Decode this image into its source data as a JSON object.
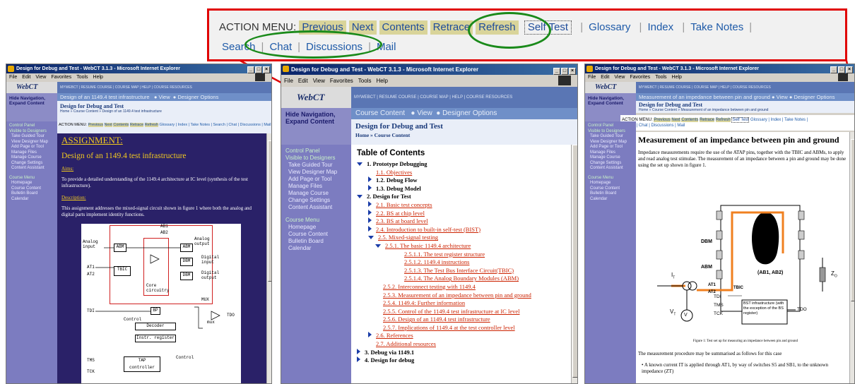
{
  "callout": {
    "action_menu": "ACTION MENU:",
    "buttons": [
      "Previous",
      "Next",
      "Contents",
      "Retrace",
      "Refresh"
    ],
    "self_test": "Self Test",
    "links_row1": [
      "Glossary",
      "Index",
      "Take Notes"
    ],
    "links_row2": [
      "Search",
      "Chat",
      "Discussions",
      "Mail"
    ]
  },
  "win1": {
    "title": "Design for Debug and Test - WebCT 3.1.3 - Microsoft Internet Explorer",
    "menu": [
      "File",
      "Edit",
      "View",
      "Favorites",
      "Tools",
      "Help"
    ],
    "logo": "WebCT",
    "topnav": "MYWEBCT | RESUME COURSE | COURSE MAP | HELP | COURSE RESOURCES",
    "hide_nav": "Hide Navigation, Expand Content",
    "crumb_title": "Design of an 1149.4 test infrastructure",
    "view": "View",
    "designer_options": "Designer Options",
    "page_title": "Design for Debug and Test",
    "breadcrumb": "Home » Course Content » Design of an 1149.4 test infrastructure",
    "action_label": "ACTION MENU:",
    "action_buttons": [
      "Previous",
      "Next",
      "Contents",
      "Retrace",
      "Refresh"
    ],
    "action_links": "Glossary | Index | Take Notes | Search | Chat | Discussions | Mail",
    "side": [
      "Control Panel",
      "Visible to Designers",
      "Take Guided Tour",
      "View Designer Map",
      "Add Page or Tool",
      "Manage Files",
      "Manage Course",
      "Change Settings",
      "Content Assistant",
      "",
      "Course Menu",
      "Homepage",
      "Course Content",
      "Bulletin Board",
      "Calendar"
    ],
    "assignment": "ASSIGNMENT:",
    "heading": "Design of an 1149.4 test infrastructure",
    "aims": "Aims:",
    "aims_text": "To provide a detailed understanding of the 1149.4 architecture at IC level (synthesis of the test infrastructure).",
    "description": "Description:",
    "desc_text": "This assignment addresses the mixed-signal circuit shown in figure 1 where both the analog and digital parts implement identity functions.",
    "circuit": {
      "ab1": "AB1",
      "ab2": "AB2",
      "analog_input": "Analog input",
      "analog_output": "Analog output",
      "digital_input": "Digital input",
      "digital_output": "Digital output",
      "abm": "ABM",
      "tbic": "TBIC",
      "at1": "AT1",
      "at2": "AT2",
      "dbm": "DBM",
      "core": "Core circuitry",
      "tdi": "TDI",
      "bp": "BP",
      "control": "Control",
      "decoder": "Decoder",
      "instr": "Instr. register",
      "mux": "MUX",
      "mux2": "mux",
      "tdo": "TDO",
      "tms": "TMS",
      "tck": "TCK",
      "tap": "TAP controller"
    }
  },
  "win2": {
    "title": "Design for Debug and Test - WebCT 3.1.3 - Microsoft Internet Explorer",
    "menu": [
      "File",
      "Edit",
      "View",
      "Favorites",
      "Tools",
      "Help"
    ],
    "logo": "WebCT",
    "topnav": "MYWEBCT | RESUME COURSE | COURSE MAP | HELP | COURSE RESOURCES",
    "hide_nav": "Hide Navigation, Expand Content",
    "course_content": "Course Content",
    "view": "View",
    "designer_options": "Designer Options",
    "page_title": "Design for Debug and Test",
    "breadcrumb": "Home » Course Content",
    "side": [
      "Control Panel",
      "Visible to Designers",
      "Take Guided Tour",
      "View Designer Map",
      "Add Page or Tool",
      "Manage Files",
      "Manage Course",
      "Change Settings",
      "Content Assistant",
      "",
      "Course Menu",
      "Homepage",
      "Course Content",
      "Bulletin Board",
      "Calendar"
    ],
    "toc_title": "Table of Contents",
    "toc": [
      {
        "t": "1. Prototype Debugging",
        "lvl": 0,
        "b": true,
        "m": "open"
      },
      {
        "t": "1.1. Objectives",
        "lvl": 1,
        "link": true
      },
      {
        "t": "1.2. Debug Flow",
        "lvl": 1,
        "b": true,
        "m": "tri"
      },
      {
        "t": "1.3. Debug Model",
        "lvl": 1,
        "b": true,
        "m": "tri"
      },
      {
        "t": "2. Design for Test",
        "lvl": 0,
        "b": true,
        "m": "open"
      },
      {
        "t": "2.1. Basic test concepts",
        "lvl": 1,
        "link": true,
        "m": "tri"
      },
      {
        "t": "2.2. BS at chip level",
        "lvl": 1,
        "link": true,
        "m": "tri"
      },
      {
        "t": "2.3. BS at board level",
        "lvl": 1,
        "link": true,
        "m": "tri"
      },
      {
        "t": "2.4. Introduction to built-in self-test (BIST)",
        "lvl": 1,
        "link": true,
        "m": "tri"
      },
      {
        "t": "2.5. Mixed-signal testing",
        "lvl": 1,
        "link": true,
        "m": "open"
      },
      {
        "t": "2.5.1. The basic 1149.4 architecture",
        "lvl": 2,
        "link": true,
        "m": "open"
      },
      {
        "t": "2.5.1.1. The test register structure",
        "lvl": 3,
        "link": true
      },
      {
        "t": "2.5.1.2. 1149.4 instructions",
        "lvl": 3,
        "link": true
      },
      {
        "t": "2.5.1.3. The Test Bus Interface Circuit(TBIC)",
        "lvl": 3,
        "link": true
      },
      {
        "t": "2.5.1.4. The Analog Boundary Modules (ABM)",
        "lvl": 3,
        "link": true
      },
      {
        "t": "2.5.2. Interconnect testing with 1149.4",
        "lvl": 2,
        "link": true
      },
      {
        "t": "2.5.3. Measurement of an impedance between pin and ground",
        "lvl": 2,
        "link": true
      },
      {
        "t": "2.5.4. 1149.4: Further information",
        "lvl": 2,
        "link": true
      },
      {
        "t": "2.5.5. Control of the 1149.4 test infrastructure at IC level",
        "lvl": 2,
        "link": true
      },
      {
        "t": "2.5.6. Design of an 1149.4 test infrastructure",
        "lvl": 2,
        "link": true
      },
      {
        "t": "2.5.7. Implications of 1149.4 at the test controller level",
        "lvl": 2,
        "link": true
      },
      {
        "t": "2.6. References",
        "lvl": 1,
        "link": true,
        "m": "tri"
      },
      {
        "t": "2.7. Additional resources",
        "lvl": 1,
        "link": true
      },
      {
        "t": "3. Debug via 1149.1",
        "lvl": 0,
        "b": true,
        "m": "tri"
      },
      {
        "t": "4. Design for debug",
        "lvl": 0,
        "b": true,
        "m": "tri"
      }
    ]
  },
  "win3": {
    "title": "Design for Debug and Test - WebCT 3.1.3 - Microsoft Internet Explorer",
    "menu": [
      "File",
      "Edit",
      "View",
      "Favorites",
      "Tools",
      "Help"
    ],
    "logo": "WebCT",
    "topnav": "MYWEBCT | RESUME COURSE | COURSE MAP | HELP | COURSE RESOURCES",
    "hide_nav": "Hide Navigation, Expand Content",
    "crumb_title": "Measurement of an impedance between pin and ground",
    "view": "View",
    "designer_options": "Designer Options",
    "page_title": "Design for Debug and Test",
    "breadcrumb": "Home » Course Content » Measurement of an impedance between pin and ground",
    "action_label": "ACTION MENU:",
    "action_buttons": [
      "Previous",
      "Next",
      "Contents",
      "Retrace",
      "Refresh"
    ],
    "self_test": "Self Test",
    "action_links": "Glossary | Index | Take Notes |",
    "action_links2": "Search | Chat | Discussions | Mail",
    "side": [
      "Control Panel",
      "Visible to Designers",
      "Take Guided Tour",
      "View Designer Map",
      "Add Page or Tool",
      "Manage Files",
      "Manage Course",
      "Change Settings",
      "Content Assistant",
      "",
      "Course Menu",
      "Homepage",
      "Course Content",
      "Bulletin Board",
      "Calendar"
    ],
    "heading": "Measurement of an impedance between pin and ground",
    "para": "Impedance measurements require the use of the ATAP pins, together with the TBIC and ABMs, to apply and read analog test stimulae. The measurement of an impedance between a pin and ground may be done using the set up shown in figure 1.",
    "fig": {
      "dbm": "DBM",
      "abm": "ABM",
      "ab": "(AB1, AB2)",
      "it": "I",
      "tsub": "T",
      "z": "Z",
      "zsub": "O",
      "at1": "AT1",
      "at2": "AT2",
      "tbic": "TBIC",
      "tdi": "TDI",
      "tms": "TMS",
      "tck": "TCK",
      "v": "V",
      "bst": "BST infrastructure (with the exception of the BS register)",
      "tdo": "TDO",
      "vsym": "V"
    },
    "caption": "Figure 1: Test set up for measuring an impedance between pin and ground",
    "summary": "The measurement procedure may be summarised as follows for this case",
    "bullet": "A known current IT is applied through AT1, by way of switches S5 and SB1, to the unknown impedance (ZT)"
  }
}
